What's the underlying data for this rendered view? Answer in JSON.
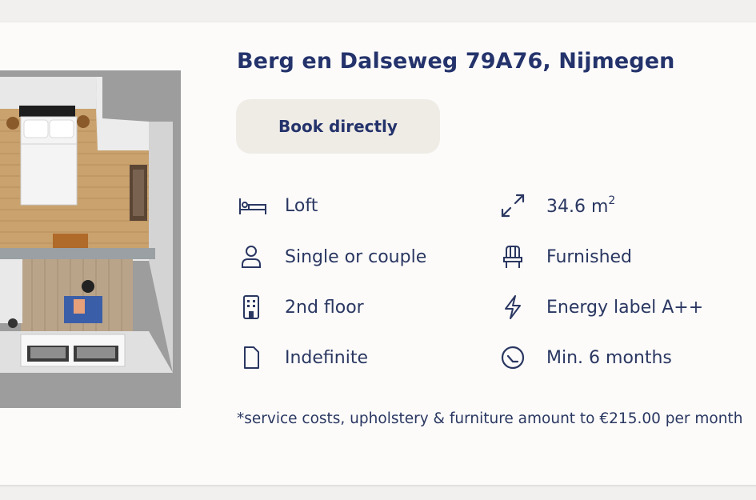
{
  "listing": {
    "title": "Berg en Dalseweg 79A76, Nijmegen",
    "book_button_label": "Book directly",
    "features": {
      "type": {
        "icon": "bed-icon",
        "label": "Loft"
      },
      "size": {
        "icon": "expand-arrows-icon",
        "label": "34.6 m",
        "unit_sup": "2"
      },
      "occupancy": {
        "icon": "person-icon",
        "label": "Single or couple"
      },
      "furnishing": {
        "icon": "chair-icon",
        "label": "Furnished"
      },
      "floor": {
        "icon": "building-icon",
        "label": "2nd floor"
      },
      "energy": {
        "icon": "lightning-icon",
        "label": "Energy label A++"
      },
      "contract": {
        "icon": "document-icon",
        "label": "Indefinite"
      },
      "minimum_stay": {
        "icon": "clock-icon",
        "label": "Min. 6 months"
      }
    },
    "footnote": "*service costs, upholstery & furniture amount to €215.00 per month"
  },
  "colors": {
    "title": "#24336b",
    "text": "#2a3761",
    "button_bg": "#efebe5",
    "card_bg": "#fcfbfa",
    "page_bg": "#f1f0ef"
  }
}
